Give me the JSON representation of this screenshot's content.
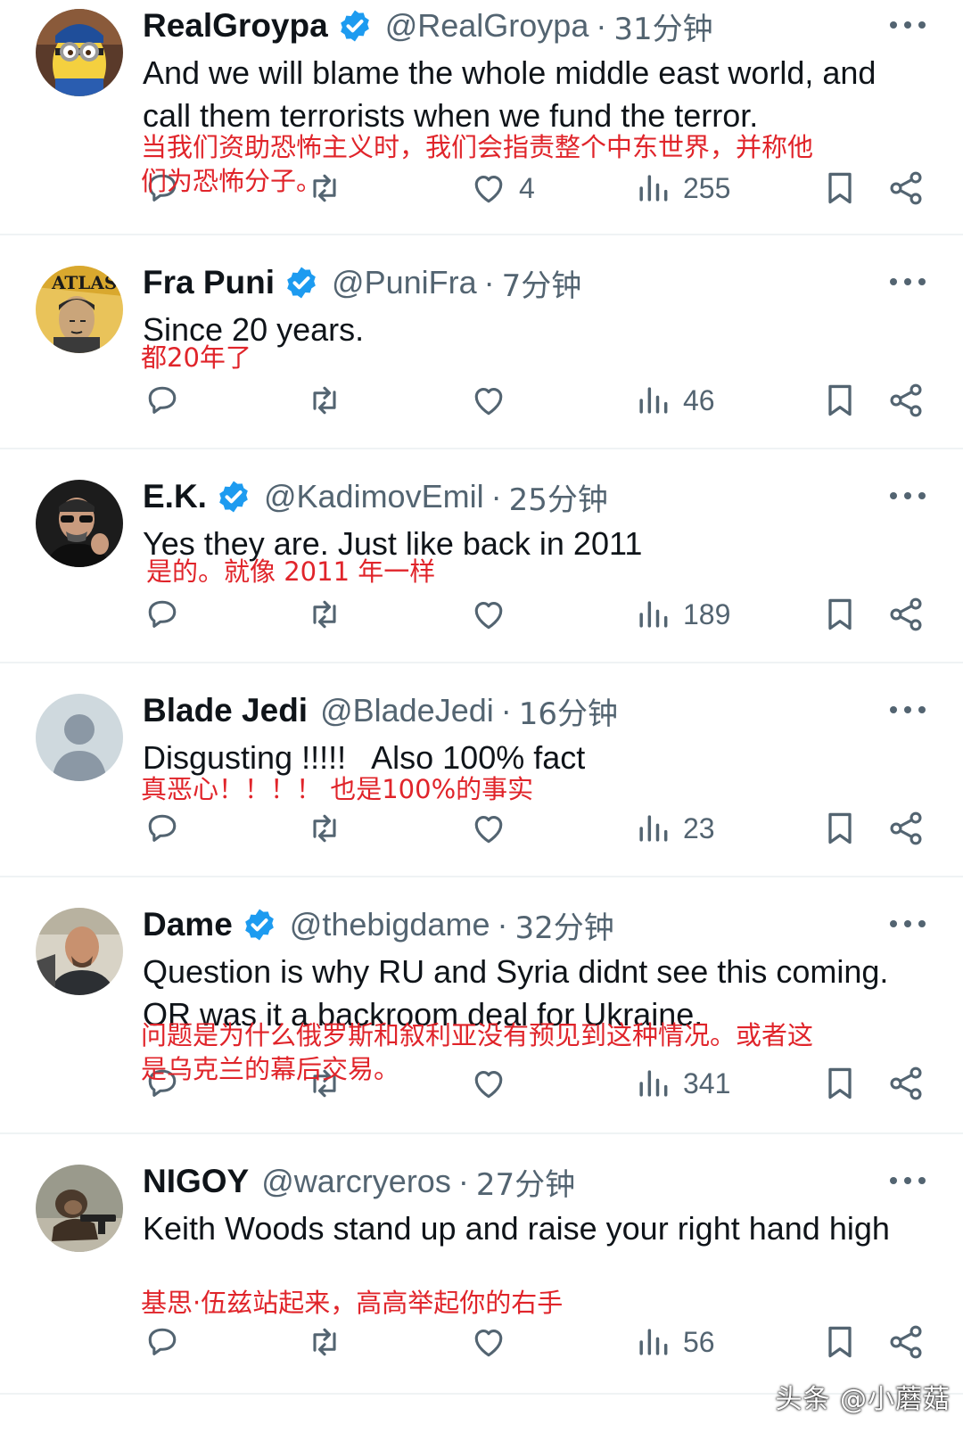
{
  "replies": [
    {
      "name": "RealGroypa",
      "verified": true,
      "handle": "@RealGroypa",
      "time": "31分钟",
      "text": "And we will blame the whole middle east world, and call them terrorists when we fund the terror.",
      "translation": "当我们资助恐怖主义时，我们会指责整个中东世界，并称他们为恐怖分子。",
      "likes": "4",
      "views": "255",
      "avatar": "minion-avatar"
    },
    {
      "name": "Fra Puni",
      "verified": true,
      "handle": "@PuniFra",
      "time": "7分钟",
      "text": "Since 20 years.",
      "translation": "都20年了",
      "likes": "",
      "views": "46",
      "avatar": "atlas-poster-avatar"
    },
    {
      "name": "E.K.",
      "verified": true,
      "handle": "@KadimovEmil",
      "time": "25分钟",
      "text": "Yes they are. Just like back in 2011",
      "translation": "是的。就像 2011 年一样",
      "likes": "",
      "views": "189",
      "avatar": "sunglasses-man-avatar"
    },
    {
      "name": "Blade Jedi",
      "verified": false,
      "handle": "@BladeJedi",
      "time": "16分钟",
      "text": "Disgusting !!!!!   Also 100% fact",
      "translation": "真恶心！！！！ 也是100%的事实",
      "likes": "",
      "views": "23",
      "avatar": "default-avatar"
    },
    {
      "name": "Dame",
      "verified": true,
      "handle": "@thebigdame",
      "time": "32分钟",
      "text": "Question is why RU and Syria didnt see this coming. OR was it a backroom deal for Ukraine.",
      "translation": "问题是为什么俄罗斯和叙利亚没有预见到这种情况。或者这是乌克兰的幕后交易。",
      "likes": "",
      "views": "341",
      "avatar": "bald-man-avatar"
    },
    {
      "name": "NIGOY",
      "verified": false,
      "handle": "@warcryeros",
      "time": "27分钟",
      "text": "Keith Woods stand up and raise your right hand high",
      "translation": "基思·伍兹站起来，高高举起你的右手",
      "likes": "",
      "views": "56",
      "avatar": "monkey-avatar"
    }
  ],
  "icons": {
    "reply": "reply-icon",
    "retweet": "retweet-icon",
    "like": "heart-icon",
    "views": "views-icon",
    "bookmark": "bookmark-icon",
    "share": "share-icon",
    "more": "more-icon",
    "verified": "verified-badge-icon"
  },
  "colors": {
    "verified": "#1d9bf0",
    "secondary_text": "#536471",
    "translation": "#e0242a",
    "divider": "#eff3f4"
  },
  "watermark": "头条 @小蘑菇"
}
